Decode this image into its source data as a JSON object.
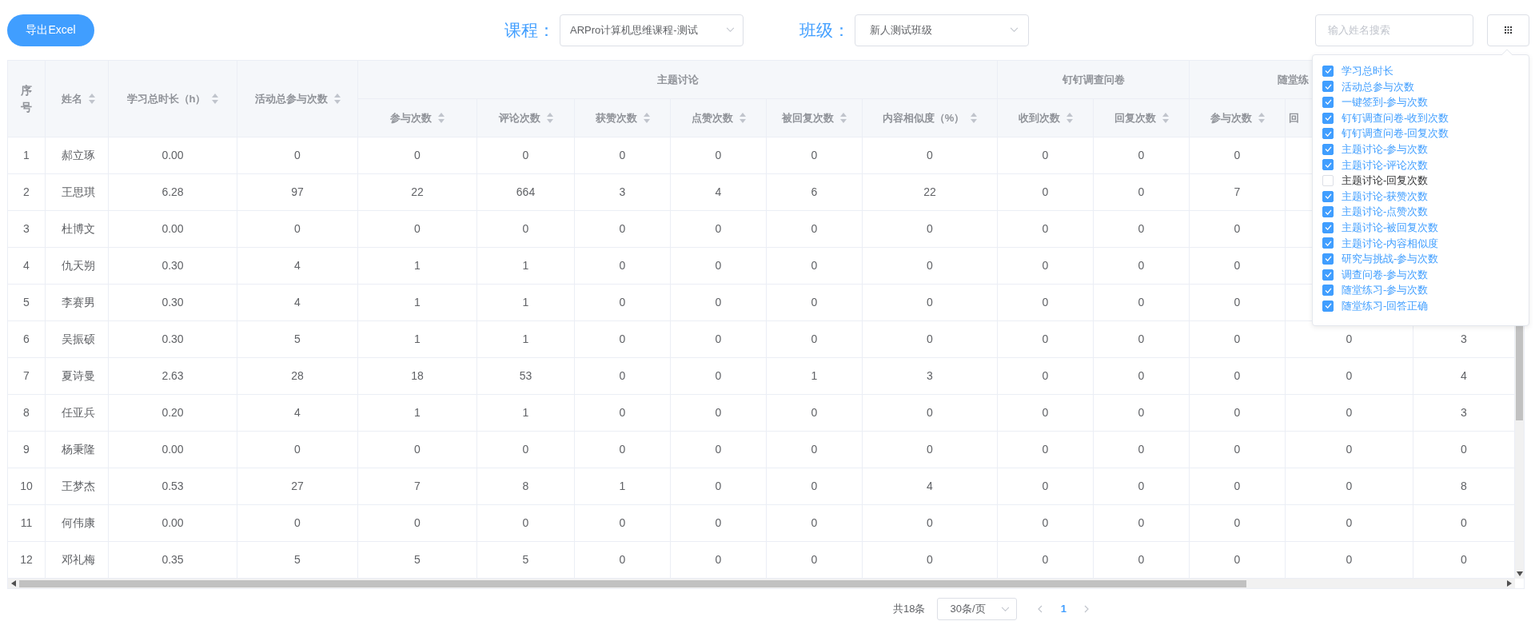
{
  "toolbar": {
    "export_button": "导出Excel",
    "course": {
      "label": "课程：",
      "value": "ARPro计算机思维课程-测试"
    },
    "class": {
      "label": "班级：",
      "value": "新人测试班级"
    },
    "search": {
      "placeholder": "输入姓名搜索"
    }
  },
  "column_settings": {
    "expanded": true,
    "items": [
      {
        "label": "学习总时长",
        "checked": true
      },
      {
        "label": "活动总参与次数",
        "checked": true
      },
      {
        "label": "一键签到-参与次数",
        "checked": true
      },
      {
        "label": "钉钉调查问卷-收到次数",
        "checked": true
      },
      {
        "label": "钉钉调查问卷-回复次数",
        "checked": true
      },
      {
        "label": "主题讨论-参与次数",
        "checked": true
      },
      {
        "label": "主题讨论-评论次数",
        "checked": true
      },
      {
        "label": "主题讨论-回复次数",
        "checked": false
      },
      {
        "label": "主题讨论-获赞次数",
        "checked": true
      },
      {
        "label": "主题讨论-点赞次数",
        "checked": true
      },
      {
        "label": "主题讨论-被回复次数",
        "checked": true
      },
      {
        "label": "主题讨论-内容相似度",
        "checked": true
      },
      {
        "label": "研究与挑战-参与次数",
        "checked": true
      },
      {
        "label": "调查问卷-参与次数",
        "checked": true
      },
      {
        "label": "随堂练习-参与次数",
        "checked": true
      },
      {
        "label": "随堂练习-回答正确",
        "checked": true
      }
    ]
  },
  "table": {
    "columns": [
      {
        "kind": "single",
        "label": "序号",
        "sortable": false
      },
      {
        "kind": "single",
        "label": "姓名",
        "sortable": true
      },
      {
        "kind": "single",
        "label": "学习总时长（h）",
        "sortable": true
      },
      {
        "kind": "single",
        "label": "活动总参与次数",
        "sortable": true
      },
      {
        "kind": "grouped",
        "group": "主题讨论",
        "label": "参与次数",
        "sortable": true
      },
      {
        "kind": "grouped",
        "label": "评论次数",
        "sortable": true
      },
      {
        "kind": "grouped",
        "label": "获赞次数",
        "sortable": true
      },
      {
        "kind": "grouped",
        "label": "点赞次数",
        "sortable": true
      },
      {
        "kind": "grouped",
        "label": "被回复次数",
        "sortable": true
      },
      {
        "kind": "grouped",
        "label": "内容相似度（%）",
        "sortable": true
      },
      {
        "kind": "grouped",
        "group": "钉钉调查问卷",
        "label": "收到次数",
        "sortable": true
      },
      {
        "kind": "grouped",
        "label": "回复次数",
        "sortable": true
      },
      {
        "kind": "grouped",
        "group": "随堂练",
        "label": "参与次数",
        "sortable": true
      },
      {
        "kind": "grouped",
        "label": "回",
        "sortable": false
      },
      {
        "kind": "blank"
      }
    ],
    "rows": [
      {
        "cells": [
          "1",
          "郝立琢",
          "0.00",
          "0",
          "0",
          "0",
          "0",
          "0",
          "0",
          "0",
          "0",
          "0",
          "0",
          null,
          null
        ]
      },
      {
        "cells": [
          "2",
          "王思琪",
          "6.28",
          "97",
          "22",
          "664",
          "3",
          "4",
          "6",
          "22",
          "0",
          "0",
          "7",
          null,
          null
        ]
      },
      {
        "cells": [
          "3",
          "杜博文",
          "0.00",
          "0",
          "0",
          "0",
          "0",
          "0",
          "0",
          "0",
          "0",
          "0",
          "0",
          null,
          null
        ]
      },
      {
        "cells": [
          "4",
          "仇天朔",
          "0.30",
          "4",
          "1",
          "1",
          "0",
          "0",
          "0",
          "0",
          "0",
          "0",
          "0",
          null,
          null
        ]
      },
      {
        "cells": [
          "5",
          "李赛男",
          "0.30",
          "4",
          "1",
          "1",
          "0",
          "0",
          "0",
          "0",
          "0",
          "0",
          "0",
          null,
          null
        ]
      },
      {
        "cells": [
          "6",
          "吴振硕",
          "0.30",
          "5",
          "1",
          "1",
          "0",
          "0",
          "0",
          "0",
          "0",
          "0",
          "0",
          "0",
          "3"
        ]
      },
      {
        "cells": [
          "7",
          "夏诗曼",
          "2.63",
          "28",
          "18",
          "53",
          "0",
          "0",
          "1",
          "3",
          "0",
          "0",
          "0",
          "0",
          "4"
        ]
      },
      {
        "cells": [
          "8",
          "任亚兵",
          "0.20",
          "4",
          "1",
          "1",
          "0",
          "0",
          "0",
          "0",
          "0",
          "0",
          "0",
          "0",
          "3"
        ]
      },
      {
        "cells": [
          "9",
          "杨秉隆",
          "0.00",
          "0",
          "0",
          "0",
          "0",
          "0",
          "0",
          "0",
          "0",
          "0",
          "0",
          "0",
          "0"
        ]
      },
      {
        "cells": [
          "10",
          "王梦杰",
          "0.53",
          "27",
          "7",
          "8",
          "1",
          "0",
          "0",
          "4",
          "0",
          "0",
          "0",
          "0",
          "8"
        ]
      },
      {
        "cells": [
          "11",
          "何伟康",
          "0.00",
          "0",
          "0",
          "0",
          "0",
          "0",
          "0",
          "0",
          "0",
          "0",
          "0",
          "0",
          "0"
        ]
      },
      {
        "cells": [
          "12",
          "邓礼梅",
          "0.35",
          "5",
          "5",
          "5",
          "0",
          "0",
          "0",
          "0",
          "0",
          "0",
          "0",
          "0",
          "0"
        ]
      }
    ]
  },
  "pagination": {
    "total": "共18条",
    "page_size": "30条/页",
    "pages": [
      {
        "label": "1",
        "selected": true
      }
    ]
  }
}
